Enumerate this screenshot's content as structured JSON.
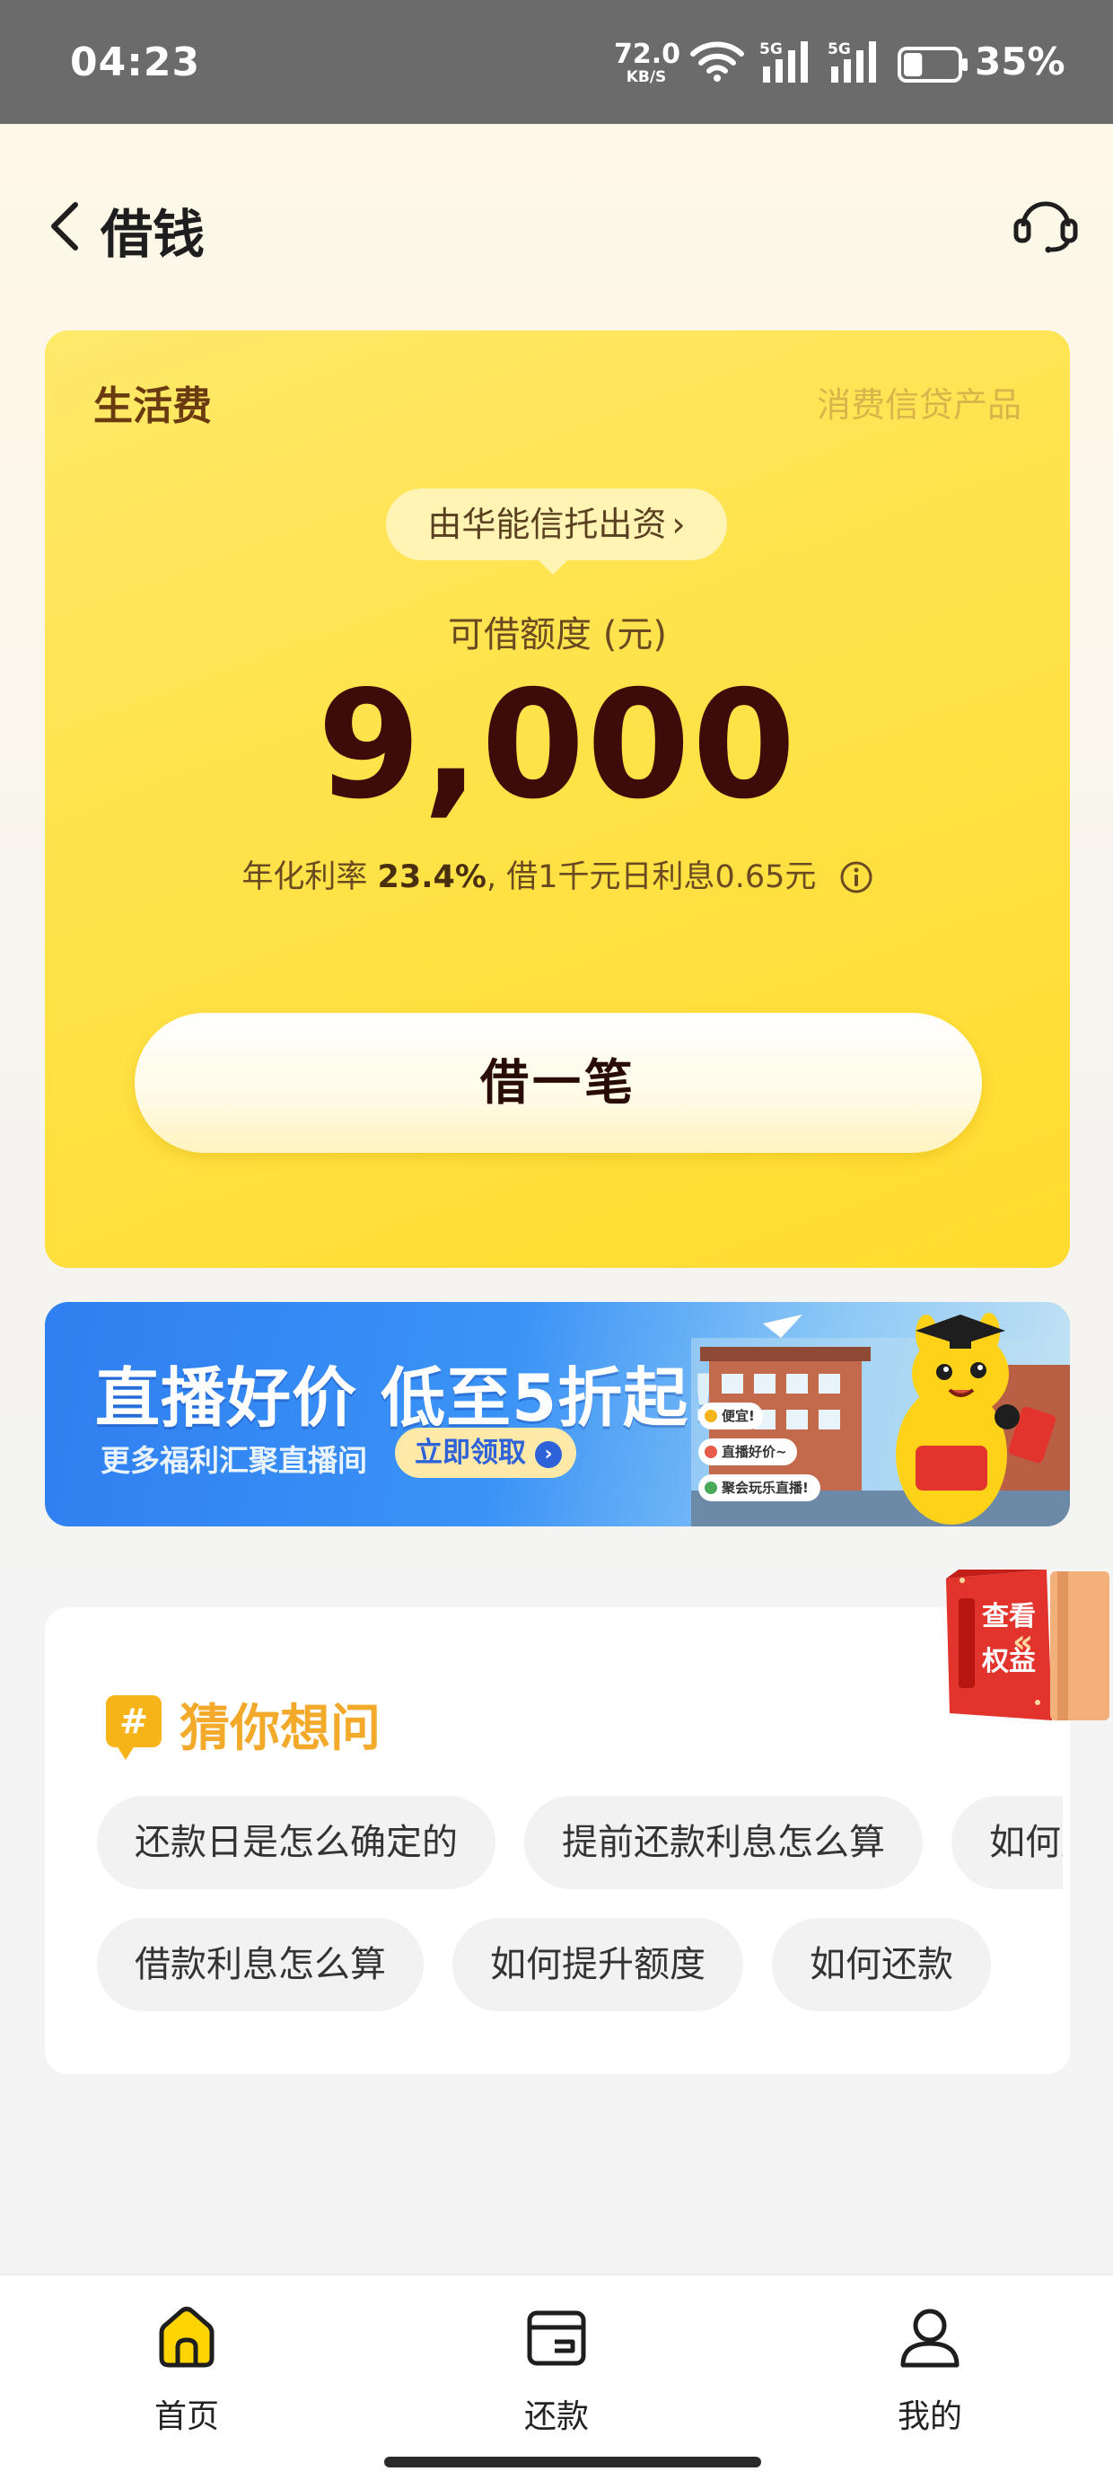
{
  "status_bar": {
    "time": "04:23",
    "net_speed_value": "72.0",
    "net_speed_unit": "KB/S",
    "signal_1_label": "5G",
    "signal_2_label": "5G",
    "battery_level": 0.35,
    "battery_text": "35%"
  },
  "header": {
    "title": "借钱",
    "back_icon": "chevron-left-icon",
    "service_icon": "headset-icon"
  },
  "loan_card": {
    "name": "生活费",
    "tag": "消费信贷产品",
    "funder": "由华能信托出资",
    "limit_label": "可借额度 (元)",
    "limit_amount": "9,000",
    "rate_prefix": "年化利率 ",
    "rate_value": "23.4%",
    "rate_suffix": ", 借1千元日利息0.65元",
    "borrow_button": "借一笔",
    "background_color": "#ffe34c"
  },
  "banner": {
    "title": "直播好价 低至5折起!",
    "subtitle": "更多福利汇聚直播间",
    "claim_button": "立即领取",
    "bubble_1": "便宜!",
    "bubble_2": "直播好价~",
    "bubble_3": "聚会玩乐直播!"
  },
  "benefit_badge": {
    "text_1": "查看",
    "text_2": "权益"
  },
  "faq": {
    "icon": "#",
    "title": "猜你想问",
    "row1": [
      "还款日是怎么确定的",
      "提前还款利息怎么算",
      "如何延期还款"
    ],
    "row2": [
      "借款利息怎么算",
      "如何提升额度",
      "如何还款"
    ]
  },
  "bottom_nav": {
    "items": [
      {
        "label": "首页",
        "icon": "home-icon",
        "active": true
      },
      {
        "label": "还款",
        "icon": "wallet-icon",
        "active": false
      },
      {
        "label": "我的",
        "icon": "user-icon",
        "active": false
      }
    ],
    "accent_color": "#ffd400"
  }
}
